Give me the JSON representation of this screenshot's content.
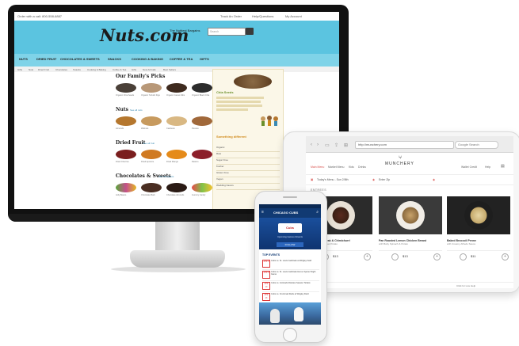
{
  "desktop": {
    "topbar": {
      "left": "Order with a call: 800-558-6887",
      "right": [
        "Track An Order",
        "Help/Questions",
        "My Account"
      ]
    },
    "logo": "Nuts.com",
    "tagline": "The Nuttiest Bargains",
    "search_placeholder": "Search",
    "nav": [
      "NUTS",
      "DRIED FRUIT",
      "CHOCOLATES & SWEETS",
      "SNACKS",
      "COOKING & BAKING",
      "COFFEE & TEA",
      "GIFTS"
    ],
    "subnav": [
      "Gifts",
      "Nuts",
      "Dried Fruit",
      "Chocolates",
      "Snacks",
      "Cooking & Baking",
      "Coffee & Tea",
      "Gifts",
      "New Arrivals",
      "Best Sellers"
    ],
    "sections": [
      {
        "title": "Our Family's Picks",
        "products": [
          "Organic Chia Seeds",
          "Organic Turkish Figs",
          "Organic Cacao Nibs",
          "Organic Black Chia"
        ]
      },
      {
        "title": "Nuts",
        "link": "See all nuts",
        "products": [
          "Almonds",
          "Walnuts",
          "Cashews",
          "Pecans"
        ]
      },
      {
        "title": "Dried Fruit",
        "link": "See all fruit",
        "products": [
          "Dried Cherries",
          "Dried Apricots",
          "Dried Mango",
          "Raisins"
        ]
      },
      {
        "title": "Chocolates & Sweets",
        "link": "See all sweets",
        "products": [
          "Jelly Beans",
          "Chocolate Bark",
          "Chocolate Almonds",
          "Gummy Candy"
        ]
      }
    ],
    "sidebar": {
      "title": "Chia Seeds",
      "title2": "Something different",
      "items": [
        "Organic",
        "Raw",
        "Sugar Free",
        "Kosher",
        "Gluten Free",
        "Vegan",
        "Wedding Favors"
      ]
    }
  },
  "tablet": {
    "url": "http://munchery.com",
    "google_search": "Google Search",
    "brand": "MUNCHERY",
    "menu_left": [
      "Main Menu",
      "Market Menu",
      "Kids",
      "Drinks"
    ],
    "menu_right": [
      "Wallet Credit",
      "Help"
    ],
    "delivery": "Today's Menu - Sun 2/8th",
    "zip_label": "Enter Zip",
    "section": "ENTREES",
    "cards": [
      {
        "name": "Grass-Fed Steak & Chimichurri",
        "desc": "with Roasted Sweet Potato",
        "price": "$13"
      },
      {
        "name": "Pan Roasted Lemon Chicken Breast",
        "desc": "with Baby Spinach & Potato",
        "price": "$13"
      },
      {
        "name": "Baked Broccoli Penne",
        "desc": "with Creamy Alfredo Sauce",
        "price": "$11"
      }
    ],
    "footer_left": "",
    "footer_right": "Click for Live Help"
  },
  "phone": {
    "app_title": "CHICAGO CUBS",
    "badge": "Cubs",
    "hero_sub": "Upcoming Games & Events",
    "hero_button": "FOLLOW",
    "events_label": "TOP EVENTS",
    "events": [
      {
        "date": "APR 6",
        "text": "Cubs vs. St. Louis Cardinals at Wrigley Field"
      },
      {
        "date": "APR 8",
        "text": "Cubs vs. St. Louis Cardinals Home Opener Night Game"
      },
      {
        "date": "APR 10",
        "text": "Cubs vs. Colorado Rockies Season Tickets"
      },
      {
        "date": "APR 13",
        "text": "Cubs vs. Cincinnati Reds at Wrigley Field"
      }
    ]
  },
  "colors": {
    "nuts_header": "#5bc4e0",
    "nuts_nav": "#7fd3e8",
    "munchery_accent": "#d9534f",
    "phone_blue": "#113a73"
  }
}
